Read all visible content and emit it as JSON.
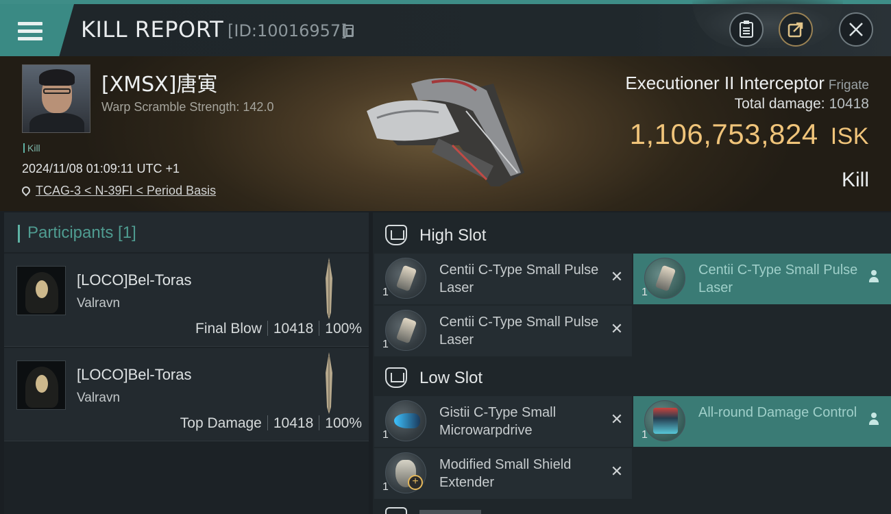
{
  "header": {
    "title": "KILL REPORT",
    "report_id": "[ID:10016957]",
    "colors": {
      "accent": "#3a8a84",
      "isk": "#f0c47a"
    }
  },
  "victim": {
    "name": "[XMSX]唐寅",
    "warp_scramble": "Warp Scramble Strength: 142.0",
    "tag": "Kill",
    "timestamp": "2024/11/08 01:09:11 UTC +1",
    "location": "TCAG-3 < N-39FI < Period Basis",
    "ship": "Executioner II Interceptor",
    "ship_class": "Frigate",
    "total_damage_label": "Total damage:",
    "total_damage": "10418",
    "isk_value": "1,106,753,824",
    "isk_unit": "ISK",
    "result": "Kill"
  },
  "participants": {
    "title": "Participants [1]",
    "rows": [
      {
        "name": "[LOCO]Bel-Toras",
        "ship": "Valravn",
        "role": "Final Blow",
        "damage": "10418",
        "percent": "100%"
      },
      {
        "name": "[LOCO]Bel-Toras",
        "ship": "Valravn",
        "role": "Top Damage",
        "damage": "10418",
        "percent": "100%"
      }
    ]
  },
  "fitting": {
    "high_slot": {
      "title": "High Slot",
      "modules": [
        {
          "name": "Centii C-Type Small Pulse Laser",
          "qty": "1",
          "icon": "pulse-laser-icon",
          "state": "destroyed"
        },
        {
          "name": "Centii C-Type Small Pulse Laser",
          "qty": "1",
          "icon": "pulse-laser-icon",
          "state": "dropped"
        },
        {
          "name": "Centii C-Type Small Pulse Laser",
          "qty": "1",
          "icon": "pulse-laser-icon",
          "state": "destroyed"
        }
      ]
    },
    "low_slot": {
      "title": "Low Slot",
      "modules": [
        {
          "name": "Gistii C-Type Small Microwarpdrive",
          "qty": "1",
          "icon": "microwarpdrive-icon",
          "state": "destroyed"
        },
        {
          "name": "All-round Damage Control",
          "qty": "1",
          "icon": "damage-control-icon",
          "state": "dropped"
        },
        {
          "name": "Modified Small Shield Extender",
          "qty": "1",
          "icon": "shield-extender-icon",
          "state": "destroyed"
        }
      ]
    }
  }
}
